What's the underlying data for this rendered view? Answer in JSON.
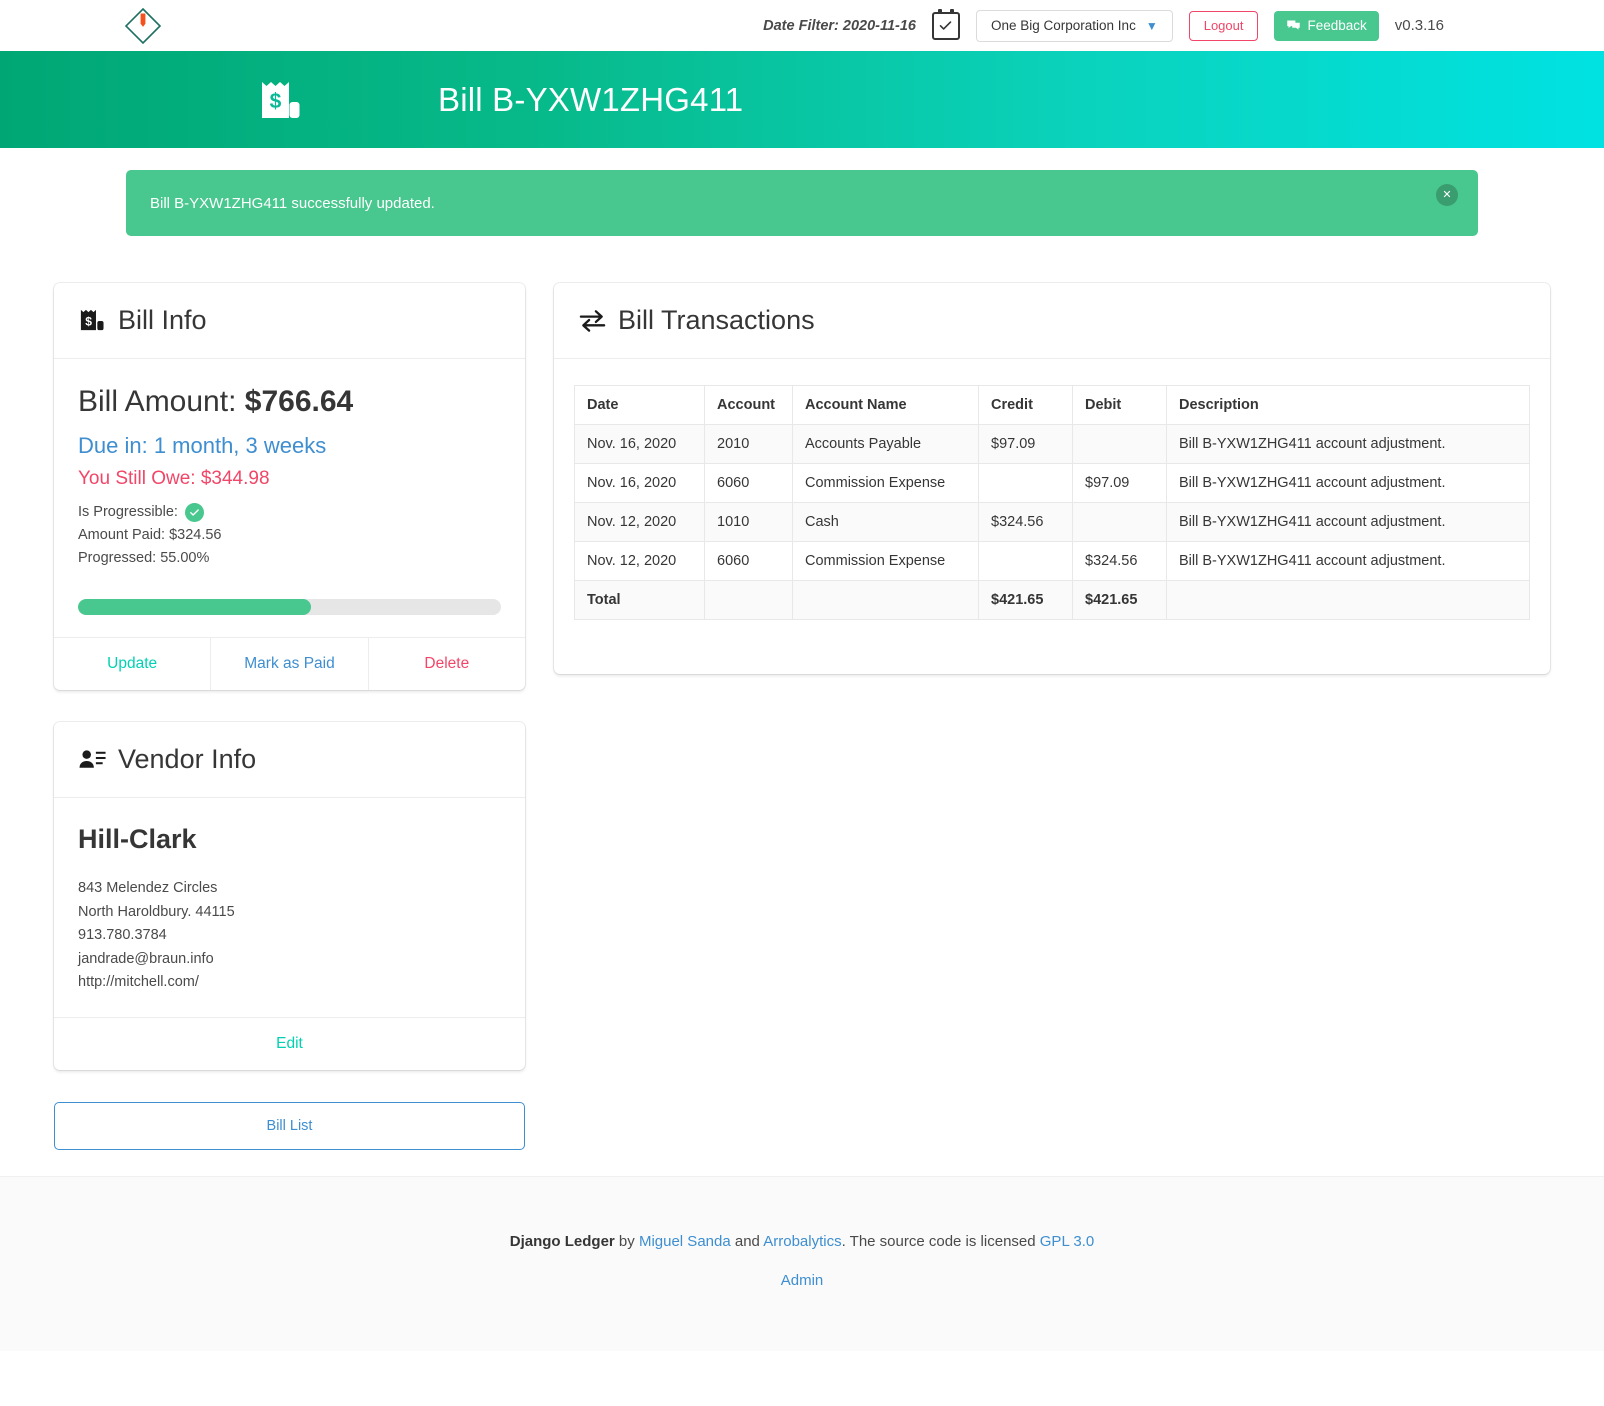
{
  "topnav": {
    "logo_name": "django-ledger-diamond-logo",
    "date_filter_label": "Date Filter: 2020-11-16",
    "calendar_icon": "calendar-check-icon",
    "entity_selected": "One Big Corporation Inc",
    "entity_options": [
      "One Big Corporation Inc"
    ],
    "logout_label": "Logout",
    "feedback_label": "Feedback",
    "feedback_icon": "comments-icon",
    "version": "v0.3.16"
  },
  "hero": {
    "icon": "receipt-dollar-icon",
    "title": "Bill B-YXW1ZHG411",
    "gradient_from": "#00a775",
    "gradient_to": "#00e2e2"
  },
  "alert": {
    "message": "Bill B-YXW1ZHG411 successfully updated.",
    "close_glyph": "✕",
    "bg": "#48c78e"
  },
  "bill_info": {
    "heading": "Bill Info",
    "icon": "receipt-dollar-icon",
    "amount_label": "Bill Amount:",
    "amount_value": "$766.64",
    "due_in": "Due in: 1 month, 3 weeks",
    "still_owe": "You Still Owe: $344.98",
    "is_progressible_label": "Is Progressible:",
    "is_progressible_value": true,
    "amount_paid": "Amount Paid: $324.56",
    "progressed": "Progressed: 55.00%",
    "progress_percent": 55,
    "progress_color": "#48c78e",
    "actions": [
      {
        "label": "Update",
        "color": "#00d1b2"
      },
      {
        "label": "Mark as Paid",
        "color": "#3e8ed0"
      },
      {
        "label": "Delete",
        "color": "#f14668"
      }
    ]
  },
  "vendor_info": {
    "heading": "Vendor Info",
    "icon": "address-card-icon",
    "name": "Hill-Clark",
    "address1": "843 Melendez Circles",
    "address2": "North Haroldbury. 44115",
    "phone": "913.780.3784",
    "email": "jandrade@braun.info",
    "website": "http://mitchell.com/",
    "edit_label": "Edit"
  },
  "bill_list_button": {
    "label": "Bill List"
  },
  "transactions": {
    "heading": "Bill Transactions",
    "icon": "exchange-arrows-icon",
    "columns": [
      "Date",
      "Account",
      "Account Name",
      "Credit",
      "Debit",
      "Description"
    ],
    "rows": [
      {
        "date": "Nov. 16, 2020",
        "account": "2010",
        "account_name": "Accounts Payable",
        "credit": "$97.09",
        "debit": "",
        "description": "Bill B-YXW1ZHG411 account adjustment."
      },
      {
        "date": "Nov. 16, 2020",
        "account": "6060",
        "account_name": "Commission Expense",
        "credit": "",
        "debit": "$97.09",
        "description": "Bill B-YXW1ZHG411 account adjustment."
      },
      {
        "date": "Nov. 12, 2020",
        "account": "1010",
        "account_name": "Cash",
        "credit": "$324.56",
        "debit": "",
        "description": "Bill B-YXW1ZHG411 account adjustment."
      },
      {
        "date": "Nov. 12, 2020",
        "account": "6060",
        "account_name": "Commission Expense",
        "credit": "",
        "debit": "$324.56",
        "description": "Bill B-YXW1ZHG411 account adjustment."
      }
    ],
    "total_row": {
      "label": "Total",
      "account": "",
      "account_name": "",
      "credit": "$421.65",
      "debit": "$421.65",
      "description": ""
    }
  },
  "footer": {
    "product": "Django Ledger",
    "by_text": " by ",
    "author": "Miguel Sanda",
    "and_text": " and ",
    "org": "Arrobalytics",
    "license_text": ". The source code is licensed ",
    "license": "GPL 3.0",
    "admin": "Admin"
  }
}
